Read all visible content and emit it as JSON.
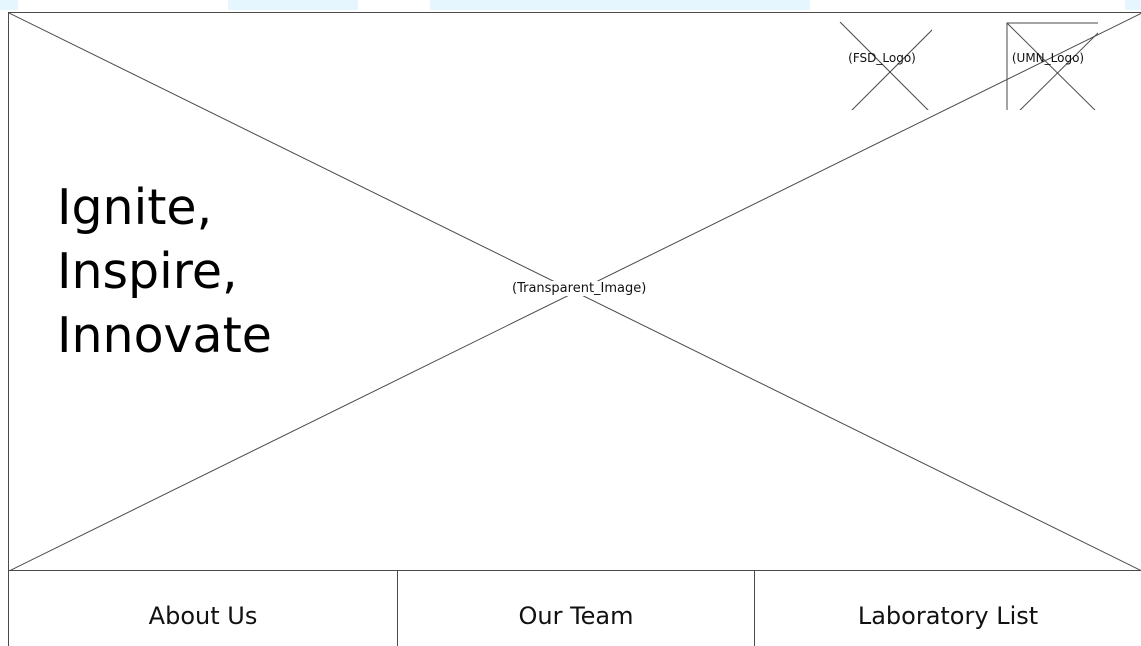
{
  "hero": {
    "image_placeholder": "(Transparent_Image)",
    "tagline": [
      "Ignite,",
      "Inspire,",
      "Innovate"
    ]
  },
  "logos": {
    "fsd": "(FSD_Logo)",
    "umn": "(UMN_Logo)"
  },
  "nav": {
    "items": [
      {
        "label": "About Us"
      },
      {
        "label": "Our Team"
      },
      {
        "label": "Laboratory List"
      }
    ]
  },
  "colors": {
    "accent": "#e6f6ff",
    "line": "#4a4a4a",
    "text": "#111111",
    "background": "#ffffff"
  }
}
